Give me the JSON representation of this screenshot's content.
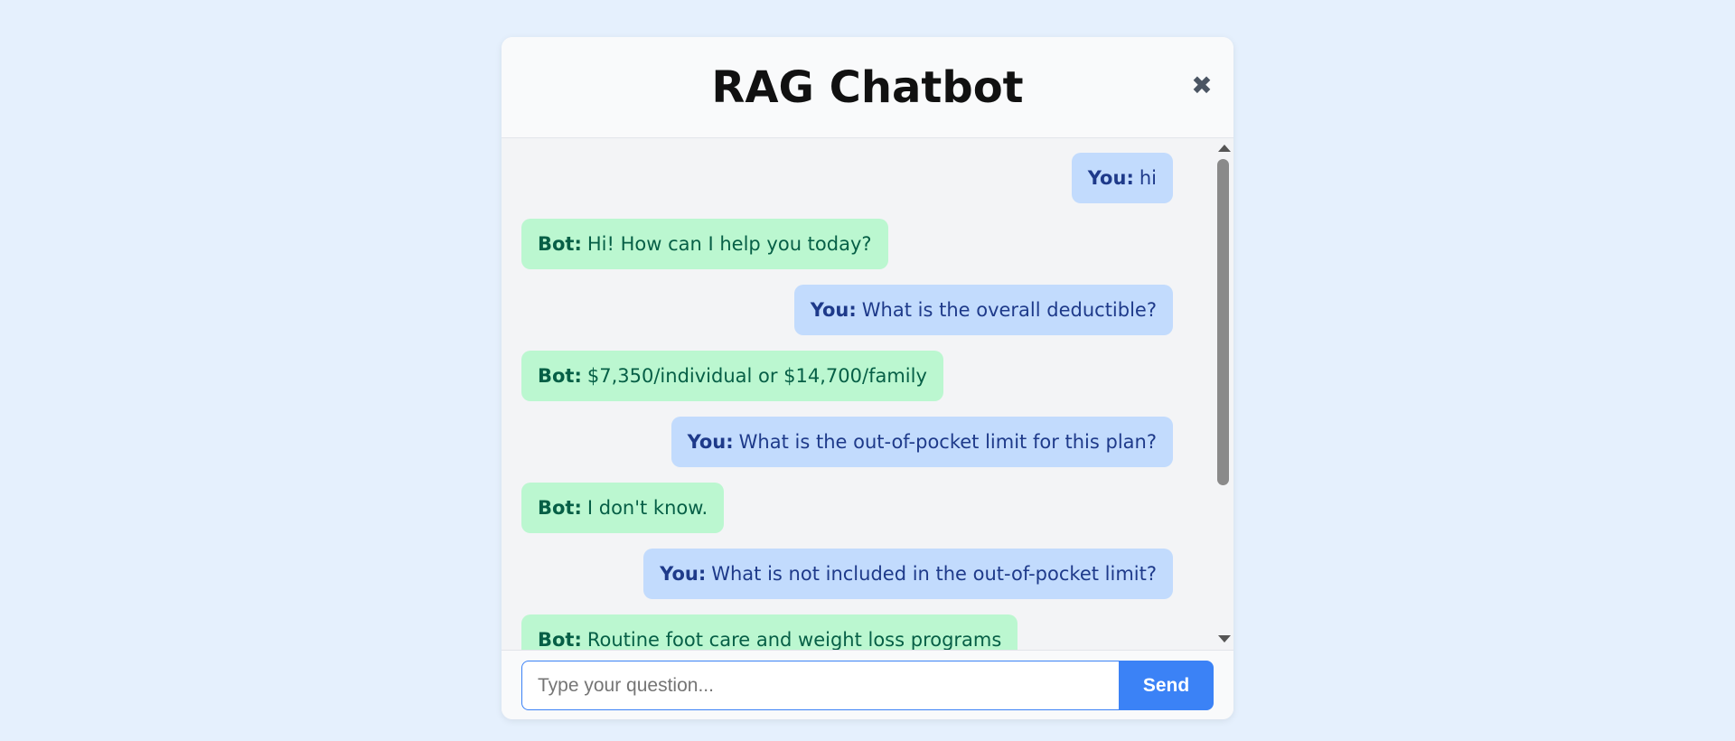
{
  "header": {
    "title": "RAG Chatbot",
    "close_glyph": "✖",
    "close_icon": "close-icon"
  },
  "messages": [
    {
      "sender": "user",
      "who": "You:",
      "text": "hi"
    },
    {
      "sender": "bot",
      "who": "Bot:",
      "text": "Hi! How can I help you today?"
    },
    {
      "sender": "user",
      "who": "You:",
      "text": "What is the overall deductible?"
    },
    {
      "sender": "bot",
      "who": "Bot:",
      "text": "$7,350/individual or $14,700/family"
    },
    {
      "sender": "user",
      "who": "You:",
      "text": "What is the out-of-pocket limit for this plan?"
    },
    {
      "sender": "bot",
      "who": "Bot:",
      "text": "I don't know."
    },
    {
      "sender": "user",
      "who": "You:",
      "text": "What is not included in the out-of-pocket limit?"
    },
    {
      "sender": "bot",
      "who": "Bot:",
      "text": "Routine foot care and weight loss programs"
    }
  ],
  "composer": {
    "placeholder": "Type your question...",
    "value": "",
    "send_label": "Send"
  },
  "colors": {
    "page_background": "#e5f0fd",
    "user_bubble": "#c2dbfd",
    "user_text": "#1e3a8a",
    "bot_bubble": "#bbf7d0",
    "bot_text": "#065f46",
    "accent": "#3b82f6"
  }
}
